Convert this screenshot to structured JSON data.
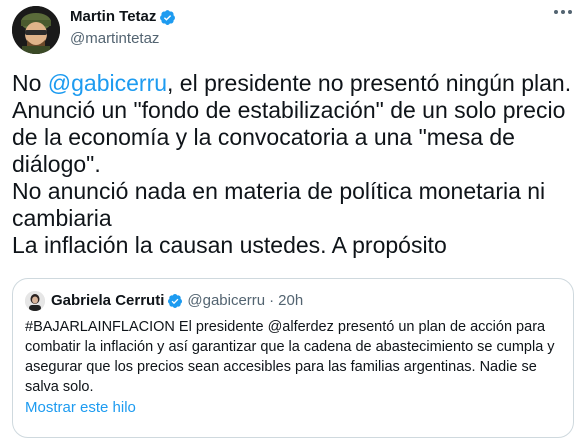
{
  "tweet": {
    "author": {
      "display_name": "Martin Tetaz",
      "handle": "@martintetaz",
      "verified_icon": "verified-badge-icon"
    },
    "text_prefix": "No ",
    "mention": "@gabicerru",
    "text_rest": ", el presidente no presentó ningún plan.\nAnunció un \"fondo de estabilización\" de un solo precio de la economía y la convocatoria a una \"mesa de diálogo\".\nNo anunció nada en materia de política monetaria ni cambiaria\nLa inflación la causan ustedes. A propósito",
    "more_icon": "more-options-icon"
  },
  "quoted_tweet": {
    "author": {
      "display_name": "Gabriela Cerruti",
      "handle": "@gabicerru",
      "separator": "·",
      "time": "20h"
    },
    "text": "#BAJARLAINFLACION El presidente @alferdez presentó un plan de acción para combatir la inflación y así garantizar que la cadena de abastecimiento se cumpla y asegurar que los precios sean accesibles para las familias argentinas. Nadie se salva solo.",
    "show_thread": "Mostrar este hilo"
  },
  "colors": {
    "accent": "#1d9bf0",
    "text": "#0f1419",
    "secondary": "#536471",
    "border": "#cfd9de"
  }
}
